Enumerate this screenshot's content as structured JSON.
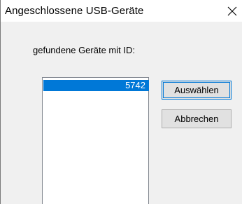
{
  "window": {
    "title": "Angeschlossene USB-Geräte",
    "close_icon": "close-icon"
  },
  "dialog": {
    "prompt": "gefundene Geräte mit ID:",
    "devices": [
      {
        "id": "5742",
        "selected": true
      }
    ],
    "buttons": {
      "select_label": "Auswählen",
      "cancel_label": "Abbrechen"
    }
  },
  "colors": {
    "selection": "#0078d7",
    "titlebar": "#ffffff",
    "dialog_bg": "#f0f0f0"
  }
}
